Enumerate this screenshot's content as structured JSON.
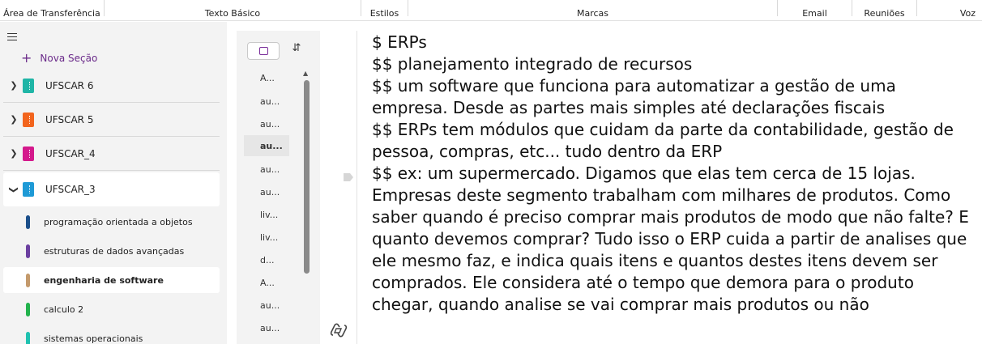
{
  "ribbon": {
    "groups": [
      "Área de Transferência",
      "Texto Básico",
      "Estilos",
      "Marcas",
      "Email",
      "Reuniões",
      "Voz"
    ]
  },
  "sections_pane": {
    "new_section_label": "Nova Seção",
    "notebooks": [
      {
        "name": "UFSCAR 6",
        "color": "#1fb5a6",
        "expanded": false
      },
      {
        "name": "UFSCAR 5",
        "color": "#f2641d",
        "expanded": false
      },
      {
        "name": "UFSCAR_4",
        "color": "#d4198c",
        "expanded": false
      },
      {
        "name": "UFSCAR_3",
        "color": "#1e9ad6",
        "expanded": true
      }
    ],
    "sections": [
      {
        "name": "programação orientada a objetos",
        "color": "#1b4f8a"
      },
      {
        "name": "estruturas de dados avançadas",
        "color": "#6b3fa0"
      },
      {
        "name": "engenharia de software",
        "color": "#c49a6c",
        "active": true
      },
      {
        "name": "calculo 2",
        "color": "#22b24c"
      },
      {
        "name": "sistemas operacionais",
        "color": "#1fc1b0"
      }
    ]
  },
  "pages_pane": {
    "pages": [
      "A...",
      "au...",
      "au...",
      "au...",
      "au...",
      "au...",
      "liv...",
      "liv...",
      "d...",
      "A...",
      "au...",
      "au..."
    ],
    "active_index": 3
  },
  "note": {
    "lines": [
      "$ ERPs",
      "$$ planejamento integrado de recursos",
      "$$ um software que funciona para automatizar a gestão de uma",
      "empresa. Desde as partes mais simples até declarações fiscais",
      "$$ ERPs tem módulos que cuidam da parte da contabilidade, gestão de",
      "pessoa, compras, etc... tudo dentro da ERP",
      "$$ ex: um supermercado. Digamos que elas tem cerca de 15 lojas.",
      "Empresas deste segmento trabalham com milhares de produtos. Como",
      "saber quando é preciso comprar mais produtos de modo que não falte? E",
      "quanto devemos comprar? Tudo isso o ERP cuida a partir de analises que",
      "ele mesmo faz, e indica quais itens e quantos destes itens devem ser",
      "comprados. Ele considera até o tempo que demora para o produto",
      "chegar, quando analise se vai comprar mais produtos ou não"
    ]
  }
}
